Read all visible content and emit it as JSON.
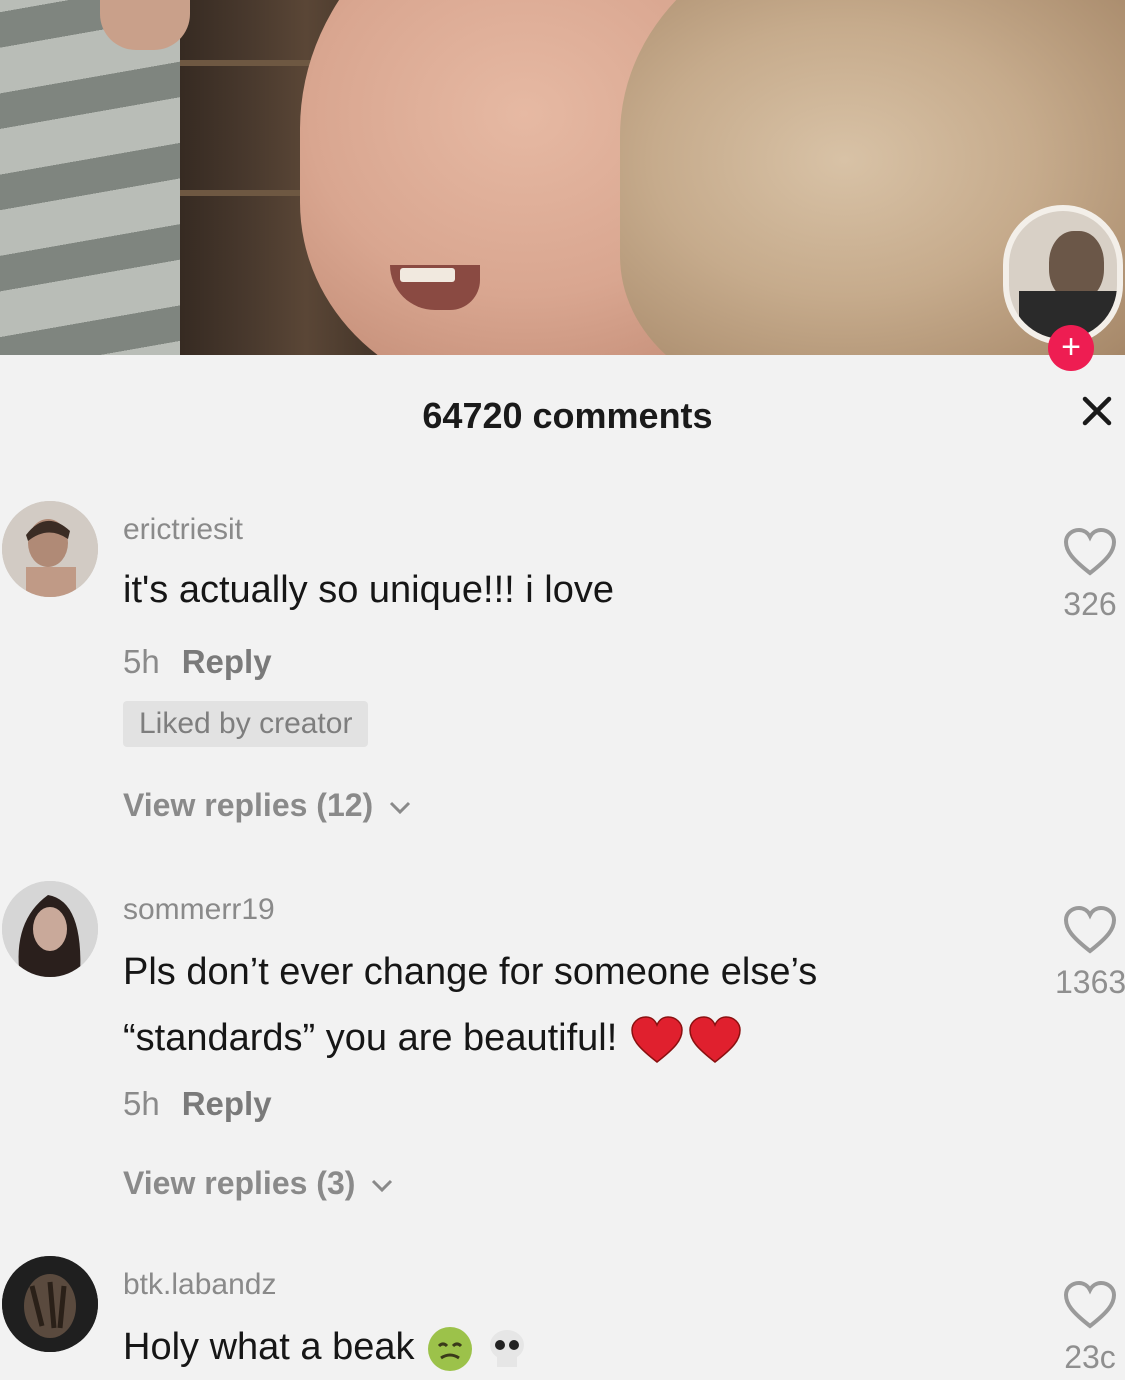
{
  "sheet": {
    "title": "64720 comments"
  },
  "comments": [
    {
      "username": "erictriesit",
      "text": "it's actually so unique!!! i love",
      "time": "5h",
      "reply_label": "Reply",
      "liked_by_creator": "Liked by creator",
      "view_replies": "View replies (12)",
      "likes": "326"
    },
    {
      "username": "sommerr19",
      "text_line1": "Pls don’t ever change for someone else’s",
      "text_line2": "“standards” you are beautiful!",
      "time": "5h",
      "reply_label": "Reply",
      "view_replies": "View replies (3)",
      "likes": "1363"
    },
    {
      "username": "btk.labandz",
      "text": "Holy what a beak",
      "likes": "23c"
    }
  ],
  "colors": {
    "sheet_bg": "#f2f2f2",
    "heart_emoji": "#e0202e",
    "follow_badge": "#ee1d52"
  },
  "icons": {
    "close": "close-icon",
    "like": "heart-outline-icon",
    "chevron": "chevron-down-icon"
  }
}
